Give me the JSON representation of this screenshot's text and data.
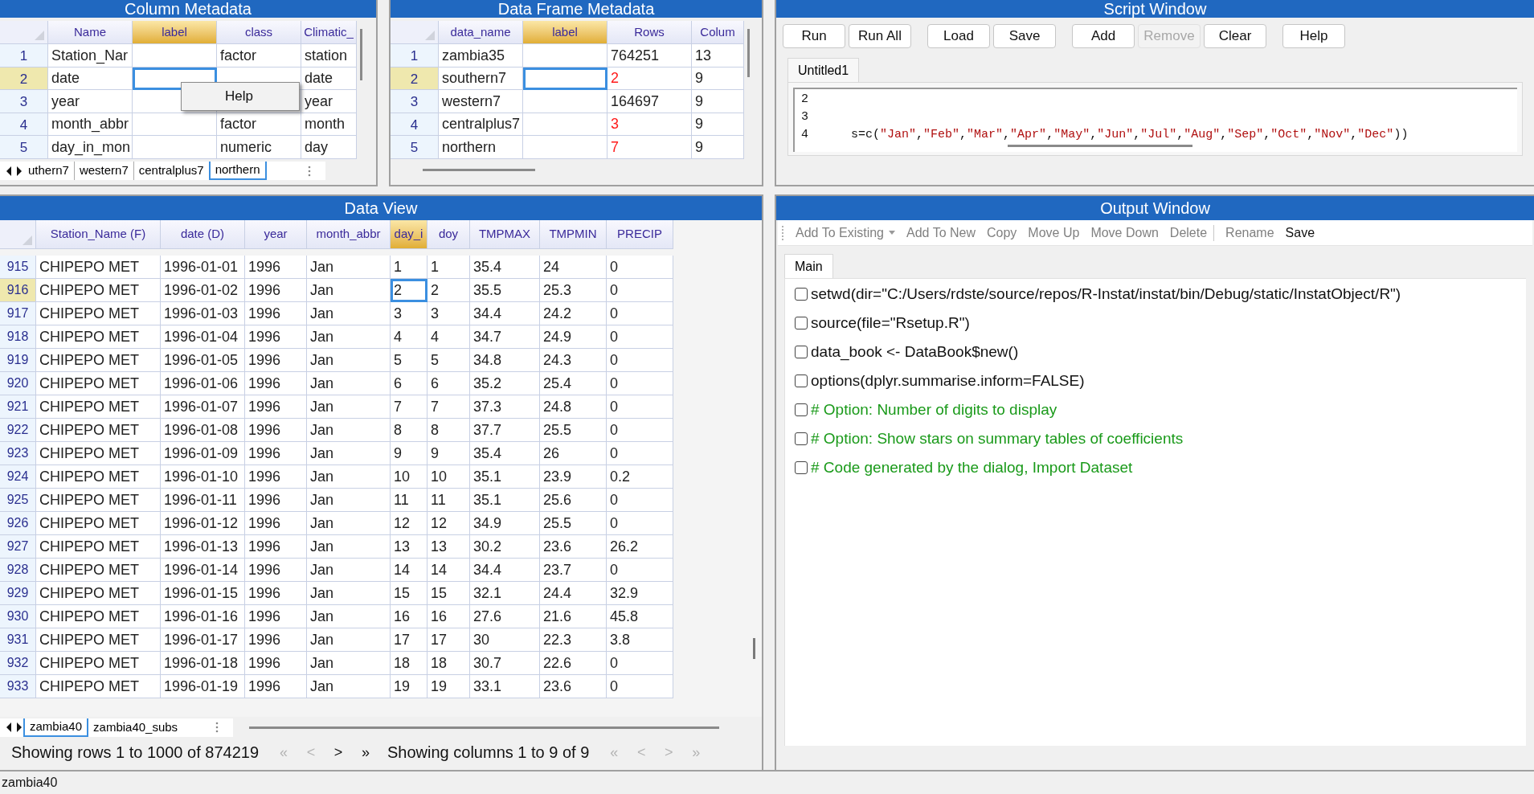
{
  "column_metadata": {
    "title": "Column Metadata",
    "columns": [
      {
        "label": "Name",
        "selected": false
      },
      {
        "label": "label",
        "selected": true
      },
      {
        "label": "class",
        "selected": false
      },
      {
        "label": "Climatic_",
        "selected": false
      }
    ],
    "rows": [
      {
        "number": "1",
        "selected": false,
        "name": "Station_Nar",
        "class": "factor",
        "climatic": "station"
      },
      {
        "number": "2",
        "selected": true,
        "name": "date",
        "climatic": "date"
      },
      {
        "number": "3",
        "selected": false,
        "name": "year",
        "climatic": "year"
      },
      {
        "number": "4",
        "selected": false,
        "name": "month_abbr",
        "class": "factor",
        "climatic": "month"
      },
      {
        "number": "5",
        "selected": false,
        "name": "day_in_mon",
        "class": "numeric",
        "climatic": "day"
      }
    ],
    "sheet_tabs": [
      {
        "label": "uthern7",
        "selected": false
      },
      {
        "label": "western7",
        "selected": false
      },
      {
        "label": "centralplus7",
        "selected": false
      },
      {
        "label": "northern",
        "selected": true
      }
    ],
    "context_menu": {
      "items": [
        "Help"
      ]
    }
  },
  "data_frame_metadata": {
    "title": "Data Frame Metadata",
    "columns": [
      {
        "label": "data_name",
        "selected": false
      },
      {
        "label": "label",
        "selected": true
      },
      {
        "label": "Rows",
        "selected": false
      },
      {
        "label": "Colum",
        "selected": false
      }
    ],
    "rows": [
      {
        "number": "1",
        "selected": false,
        "data_name": "zambia35",
        "rows": "764251",
        "flagged": false,
        "columns": "13"
      },
      {
        "number": "2",
        "selected": true,
        "data_name": "southern7",
        "rows": "2",
        "flagged": true,
        "columns": "9"
      },
      {
        "number": "3",
        "selected": false,
        "data_name": "western7",
        "rows": "164697",
        "flagged": false,
        "columns": "9"
      },
      {
        "number": "4",
        "selected": false,
        "data_name": "centralplus7",
        "rows": "3",
        "flagged": true,
        "columns": "9"
      },
      {
        "number": "5",
        "selected": false,
        "data_name": "northern",
        "rows": "7",
        "flagged": true,
        "columns": "9"
      }
    ]
  },
  "script_window": {
    "title": "Script Window",
    "buttons": [
      {
        "label": "Run",
        "disabled": false
      },
      {
        "label": "Run All",
        "disabled": false
      },
      {
        "label": "Load",
        "disabled": false
      },
      {
        "label": "Save",
        "disabled": false
      },
      {
        "label": "Add",
        "disabled": false
      },
      {
        "label": "Remove",
        "disabled": true
      },
      {
        "label": "Clear",
        "disabled": false
      },
      {
        "label": "Help",
        "disabled": false
      }
    ],
    "tabs": [
      {
        "label": "Untitled1",
        "selected": true
      }
    ],
    "lines": [
      {
        "number": "2"
      },
      {
        "number": "3"
      },
      {
        "number": "4",
        "code": "s=c(\"Jan\",\"Feb\",\"Mar\",\"Apr\",\"May\",\"Jun\",\"Jul\",\"Aug\",\"Sep\",\"Oct\",\"Nov\",\"Dec\"))"
      }
    ]
  },
  "data_view": {
    "title": "Data View",
    "columns": [
      {
        "label": "Station_Name (F)",
        "selected": false
      },
      {
        "label": "date (D)",
        "selected": false
      },
      {
        "label": "year",
        "selected": false
      },
      {
        "label": "month_abbr",
        "selected": false
      },
      {
        "label": "day_i",
        "selected": true
      },
      {
        "label": "doy",
        "selected": false
      },
      {
        "label": "TMPMAX",
        "selected": false
      },
      {
        "label": "TMPMIN",
        "selected": false
      },
      {
        "label": "PRECIP",
        "selected": false
      }
    ],
    "rows": [
      {
        "number": "915",
        "selected": false,
        "cells": [
          "CHIPEPO MET",
          "1996-01-01",
          "1996",
          "Jan",
          "1",
          "1",
          "35.4",
          "24",
          "0"
        ]
      },
      {
        "number": "916",
        "selected": true,
        "cells": [
          "CHIPEPO MET",
          "1996-01-02",
          "1996",
          "Jan",
          "2",
          "2",
          "35.5",
          "25.3",
          "0"
        ]
      },
      {
        "number": "917",
        "selected": false,
        "cells": [
          "CHIPEPO MET",
          "1996-01-03",
          "1996",
          "Jan",
          "3",
          "3",
          "34.4",
          "24.2",
          "0"
        ]
      },
      {
        "number": "918",
        "selected": false,
        "cells": [
          "CHIPEPO MET",
          "1996-01-04",
          "1996",
          "Jan",
          "4",
          "4",
          "34.7",
          "24.9",
          "0"
        ]
      },
      {
        "number": "919",
        "selected": false,
        "cells": [
          "CHIPEPO MET",
          "1996-01-05",
          "1996",
          "Jan",
          "5",
          "5",
          "34.8",
          "24.3",
          "0"
        ]
      },
      {
        "number": "920",
        "selected": false,
        "cells": [
          "CHIPEPO MET",
          "1996-01-06",
          "1996",
          "Jan",
          "6",
          "6",
          "35.2",
          "25.4",
          "0"
        ]
      },
      {
        "number": "921",
        "selected": false,
        "cells": [
          "CHIPEPO MET",
          "1996-01-07",
          "1996",
          "Jan",
          "7",
          "7",
          "37.3",
          "24.8",
          "0"
        ]
      },
      {
        "number": "922",
        "selected": false,
        "cells": [
          "CHIPEPO MET",
          "1996-01-08",
          "1996",
          "Jan",
          "8",
          "8",
          "37.7",
          "25.5",
          "0"
        ]
      },
      {
        "number": "923",
        "selected": false,
        "cells": [
          "CHIPEPO MET",
          "1996-01-09",
          "1996",
          "Jan",
          "9",
          "9",
          "35.4",
          "26",
          "0"
        ]
      },
      {
        "number": "924",
        "selected": false,
        "cells": [
          "CHIPEPO MET",
          "1996-01-10",
          "1996",
          "Jan",
          "10",
          "10",
          "35.1",
          "23.9",
          "0.2"
        ]
      },
      {
        "number": "925",
        "selected": false,
        "cells": [
          "CHIPEPO MET",
          "1996-01-11",
          "1996",
          "Jan",
          "11",
          "11",
          "35.1",
          "25.6",
          "0"
        ]
      },
      {
        "number": "926",
        "selected": false,
        "cells": [
          "CHIPEPO MET",
          "1996-01-12",
          "1996",
          "Jan",
          "12",
          "12",
          "34.9",
          "25.5",
          "0"
        ]
      },
      {
        "number": "927",
        "selected": false,
        "cells": [
          "CHIPEPO MET",
          "1996-01-13",
          "1996",
          "Jan",
          "13",
          "13",
          "30.2",
          "23.6",
          "26.2"
        ]
      },
      {
        "number": "928",
        "selected": false,
        "cells": [
          "CHIPEPO MET",
          "1996-01-14",
          "1996",
          "Jan",
          "14",
          "14",
          "34.4",
          "23.7",
          "0"
        ]
      },
      {
        "number": "929",
        "selected": false,
        "cells": [
          "CHIPEPO MET",
          "1996-01-15",
          "1996",
          "Jan",
          "15",
          "15",
          "32.1",
          "24.4",
          "32.9"
        ]
      },
      {
        "number": "930",
        "selected": false,
        "cells": [
          "CHIPEPO MET",
          "1996-01-16",
          "1996",
          "Jan",
          "16",
          "16",
          "27.6",
          "21.6",
          "45.8"
        ]
      },
      {
        "number": "931",
        "selected": false,
        "cells": [
          "CHIPEPO MET",
          "1996-01-17",
          "1996",
          "Jan",
          "17",
          "17",
          "30",
          "22.3",
          "3.8"
        ]
      },
      {
        "number": "932",
        "selected": false,
        "cells": [
          "CHIPEPO MET",
          "1996-01-18",
          "1996",
          "Jan",
          "18",
          "18",
          "30.7",
          "22.6",
          "0"
        ]
      },
      {
        "number": "933",
        "selected": false,
        "cells": [
          "CHIPEPO MET",
          "1996-01-19",
          "1996",
          "Jan",
          "19",
          "19",
          "33.1",
          "23.6",
          "0"
        ]
      }
    ],
    "sheet_tabs": [
      {
        "label": "zambia40",
        "selected": true
      },
      {
        "label": "zambia40_subs",
        "selected": false
      }
    ],
    "rows_info": "Showing rows 1 to 1000 of 874219",
    "rows_nav": [
      {
        "label": "«",
        "disabled": true
      },
      {
        "label": "<",
        "disabled": true
      },
      {
        "label": ">",
        "disabled": false
      },
      {
        "label": "»",
        "disabled": false
      }
    ],
    "columns_info": "Showing columns 1 to 9 of 9",
    "columns_nav": [
      {
        "label": "«",
        "disabled": true
      },
      {
        "label": "<",
        "disabled": true
      },
      {
        "label": ">",
        "disabled": true
      },
      {
        "label": "»",
        "disabled": true
      }
    ]
  },
  "output_window": {
    "title": "Output Window",
    "toolbar": [
      {
        "label": "Add To Existing",
        "kind": "dropdown",
        "disabled": true
      },
      {
        "label": "Add To New",
        "kind": "button",
        "disabled": true
      },
      {
        "label": "Copy",
        "kind": "button",
        "disabled": true
      },
      {
        "label": "Move Up",
        "kind": "button",
        "disabled": true
      },
      {
        "label": "Move Down",
        "kind": "button",
        "disabled": true
      },
      {
        "label": "Delete",
        "kind": "button",
        "disabled": true
      },
      {
        "label": "Rename",
        "kind": "separated",
        "disabled": true
      },
      {
        "label": "Save",
        "kind": "button",
        "disabled": false
      }
    ],
    "tabs": [
      {
        "label": "Main",
        "selected": true
      }
    ],
    "entries": [
      {
        "text": "setwd(dir=\"C:/Users/rdste/source/repos/R-Instat/instat/bin/Debug/static/InstatObject/R\")",
        "kind": "command",
        "checked": false
      },
      {
        "text": "source(file=\"Rsetup.R\")",
        "kind": "command",
        "checked": false
      },
      {
        "text": "data_book <- DataBook$new()",
        "kind": "command",
        "checked": false
      },
      {
        "text": "options(dplyr.summarise.inform=FALSE)",
        "kind": "command",
        "checked": false
      },
      {
        "text": "# Option: Number of digits to display",
        "kind": "comment",
        "checked": false
      },
      {
        "text": "# Option: Show stars on summary tables of coefficients",
        "kind": "comment",
        "checked": false
      },
      {
        "text": "# Code generated by the dialog, Import Dataset",
        "kind": "comment",
        "checked": false
      }
    ]
  },
  "status_bar": {
    "text": "zambia40"
  }
}
